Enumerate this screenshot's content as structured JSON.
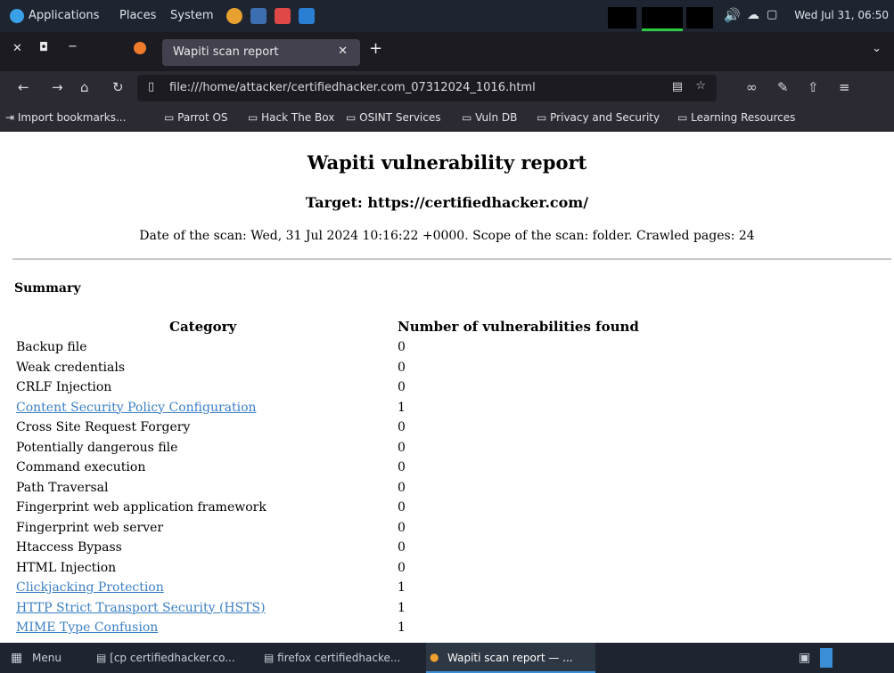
{
  "system_panel": {
    "menus": [
      "Applications",
      "Places",
      "System"
    ],
    "clock": "Wed Jul 31, 06:50"
  },
  "browser": {
    "tab_title": "Wapiti scan report",
    "url": "file:///home/attacker/certifiedhacker.com_07312024_1016.html",
    "bookmarks": [
      "Import bookmarks...",
      "Parrot OS",
      "Hack The Box",
      "OSINT Services",
      "Vuln DB",
      "Privacy and Security",
      "Learning Resources"
    ]
  },
  "report": {
    "title": "Wapiti vulnerability report",
    "target": "Target: https://certifiedhacker.com/",
    "meta": "Date of the scan: Wed, 31 Jul 2024 10:16:22 +0000. Scope of the scan: folder. Crawled pages: 24",
    "summary_heading": "Summary",
    "col_category": "Category",
    "col_count": "Number of vulnerabilities found",
    "rows": [
      {
        "category": "Backup file",
        "count": "0",
        "link": false
      },
      {
        "category": "Weak credentials",
        "count": "0",
        "link": false
      },
      {
        "category": "CRLF Injection",
        "count": "0",
        "link": false
      },
      {
        "category": "Content Security Policy Configuration",
        "count": "1",
        "link": true
      },
      {
        "category": "Cross Site Request Forgery",
        "count": "0",
        "link": false
      },
      {
        "category": "Potentially dangerous file",
        "count": "0",
        "link": false
      },
      {
        "category": "Command execution",
        "count": "0",
        "link": false
      },
      {
        "category": "Path Traversal",
        "count": "0",
        "link": false
      },
      {
        "category": "Fingerprint web application framework",
        "count": "0",
        "link": false
      },
      {
        "category": "Fingerprint web server",
        "count": "0",
        "link": false
      },
      {
        "category": "Htaccess Bypass",
        "count": "0",
        "link": false
      },
      {
        "category": "HTML Injection",
        "count": "0",
        "link": false
      },
      {
        "category": "Clickjacking Protection",
        "count": "1",
        "link": true
      },
      {
        "category": "HTTP Strict Transport Security (HSTS)",
        "count": "1",
        "link": true
      },
      {
        "category": "MIME Type Confusion",
        "count": "1",
        "link": true
      }
    ]
  },
  "taskbar": {
    "menu_label": "Menu",
    "tasks": [
      "[cp certifiedhacker.co...",
      "firefox certifiedhacke...",
      "Wapiti scan report — ..."
    ]
  }
}
